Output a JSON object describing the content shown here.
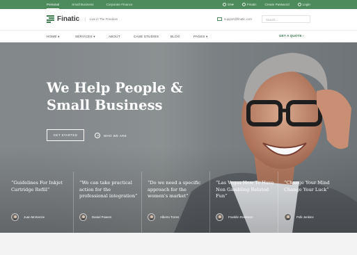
{
  "topbar": {
    "links": [
      "Personal",
      "Small Business",
      "Corporate Finance"
    ],
    "language": "EN",
    "location": "Finatic",
    "password_link": "Create Password",
    "login_link": "Login"
  },
  "header": {
    "logo": "Finatic",
    "tagline": "Live in The Freedom",
    "email": "support@finatic.com",
    "search_placeholder": "Search..."
  },
  "nav": {
    "items": [
      "HOME",
      "SERVICES",
      "ABOUT",
      "CASE STUDIES",
      "BLOG",
      "PAGES"
    ],
    "quote_label": "GET A QUOTE"
  },
  "hero": {
    "headline_line1": "We Help People &",
    "headline_line2": "Small Business",
    "cta_label": "GET STARTED",
    "video_label": "WHO WE ARE"
  },
  "testimonials": [
    {
      "quote": "“Guidelines For Inkjet Cartridge Refill”",
      "name": "Juan McKenzie"
    },
    {
      "quote": "“We can take practical action for the professional integration”",
      "name": "Daniel Powers"
    },
    {
      "quote": "“Do we need a specific approach for the women's market”",
      "name": "Alberto Torres"
    },
    {
      "quote": "“Las Vegas How To Have Non Gambling Related Fun”",
      "name": "Franklin Robinson"
    },
    {
      "quote": "“Change Your Mind Change Your Luck”",
      "name": "Polk Jenkins"
    }
  ],
  "colors": {
    "brand_green": "#4e8b5c",
    "accent_green": "#3c7a4d"
  }
}
